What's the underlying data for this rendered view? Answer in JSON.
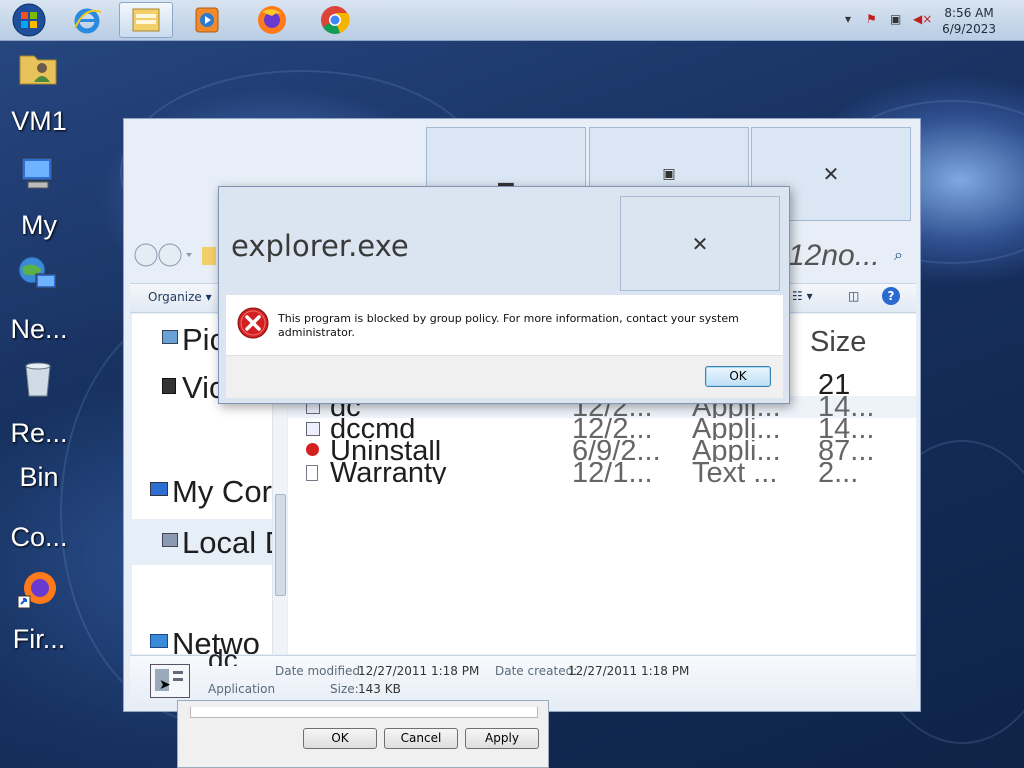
{
  "taskbar": {
    "start": "start-orb-icon",
    "pinned": [
      "internet-explorer-icon",
      "windows-explorer-icon",
      "media-player-icon",
      "firefox-icon",
      "chrome-icon"
    ],
    "clock_time": "8:56 AM",
    "clock_date": "6/9/2023"
  },
  "desktop_icons": [
    {
      "label": "VM1",
      "icon": "user-folder-icon"
    },
    {
      "label": "My",
      "icon": "my-computer-icon"
    },
    {
      "label": "Ne...",
      "icon": "network-icon"
    },
    {
      "label": "Re...",
      "icon": "recycle-bin-icon"
    },
    {
      "label": "Bin",
      "icon": ""
    },
    {
      "label": "Co...",
      "icon": ""
    },
    {
      "label": "Fir...",
      "icon": "firefox-shortcut-icon"
    }
  ],
  "explorer": {
    "search_placeholder": "12no...",
    "organize_label": "Organize",
    "column_size": "Size",
    "nav_items": [
      {
        "label": "Pic",
        "icon": "pictures-icon"
      },
      {
        "label": "Vic",
        "icon": "videos-icon"
      },
      {
        "label": "My Cor",
        "icon": "computer-icon"
      },
      {
        "label": "Local D",
        "icon": "local-disk-icon"
      },
      {
        "label": "Netwo",
        "icon": "network-icon"
      }
    ],
    "files": [
      {
        "name": "",
        "date": "",
        "type": "",
        "size": "21"
      },
      {
        "name": "dc",
        "date": "12/2...",
        "type": "Appli...",
        "size": "14..."
      },
      {
        "name": "dccmd",
        "date": "12/2...",
        "type": "Appli...",
        "size": "14..."
      },
      {
        "name": "Uninstall",
        "date": "6/9/2...",
        "type": "Appli...",
        "size": "87..."
      },
      {
        "name": "Warranty",
        "date": "12/1...",
        "type": "Text ...",
        "size": "2..."
      }
    ],
    "details": {
      "name": "dc",
      "kind": "Application",
      "modified_label": "Date modified:",
      "modified_value": "12/27/2011 1:18 PM",
      "created_label": "Date created:",
      "created_value": "12/27/2011 1:18 PM",
      "size_label": "Size:",
      "size_value": "143 KB"
    }
  },
  "properties": {
    "ok": "OK",
    "cancel": "Cancel",
    "apply": "Apply"
  },
  "error_dialog": {
    "title": "explorer.exe",
    "message": "This program is blocked by group policy. For more information, contact your system administrator.",
    "ok": "OK"
  },
  "colors": {
    "error_red": "#d32020",
    "accent_blue": "#3c7fb1"
  }
}
